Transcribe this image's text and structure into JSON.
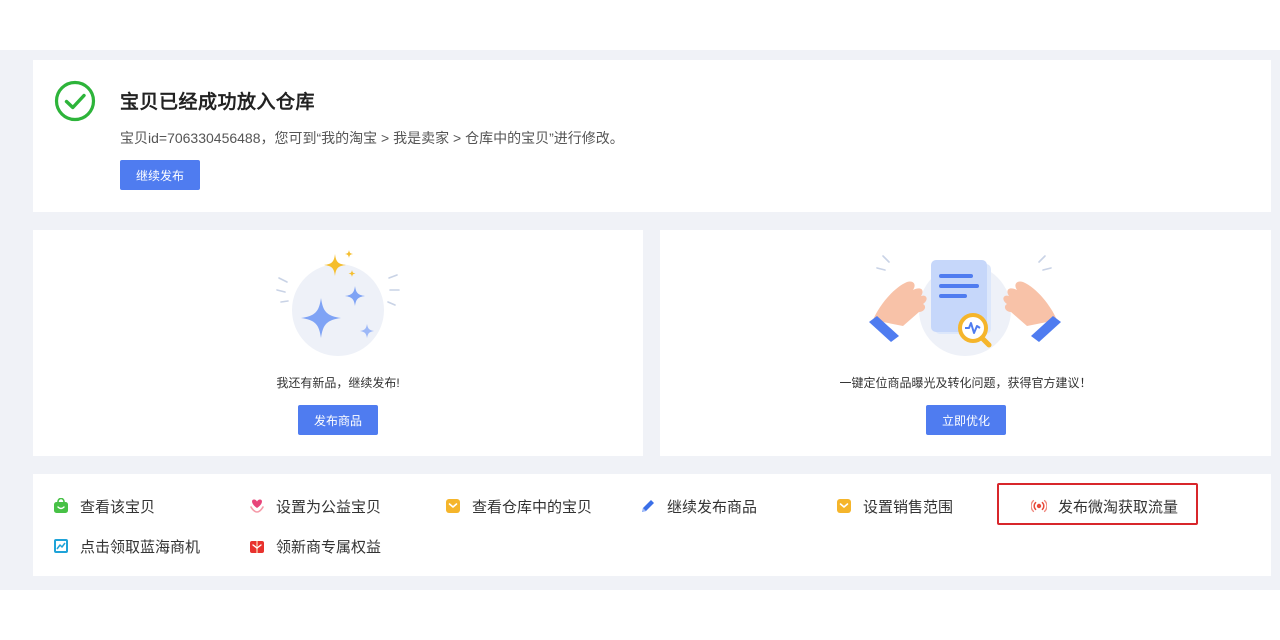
{
  "success": {
    "title": "宝贝已经成功放入仓库",
    "description": "宝贝id=706330456488，您可到“我的淘宝 > 我是卖家 > 仓库中的宝贝”进行修改。",
    "continue_button": "继续发布",
    "accent_color": "#2db43a"
  },
  "cards": [
    {
      "text": "我还有新品，继续发布!",
      "button": "发布商品",
      "illustration": "sparkle-stars-illustration"
    },
    {
      "text": "一键定位商品曝光及转化问题，获得官方建议！",
      "button": "立即优化",
      "illustration": "document-analysis-illustration"
    }
  ],
  "links": [
    {
      "label": "查看该宝贝",
      "icon": "shopping-bag-icon",
      "color": "#47c146"
    },
    {
      "label": "设置为公益宝贝",
      "icon": "heart-hand-icon",
      "color": "#e8457a"
    },
    {
      "label": "查看仓库中的宝贝",
      "icon": "box-icon",
      "color": "#f5b52b"
    },
    {
      "label": "继续发布商品",
      "icon": "pencil-icon",
      "color": "#3a6fe8"
    },
    {
      "label": "设置销售范围",
      "icon": "range-icon",
      "color": "#f5b52b"
    },
    {
      "label": "发布微淘获取流量",
      "icon": "broadcast-icon",
      "color": "#e84a3a"
    },
    {
      "label": "点击领取蓝海商机",
      "icon": "chart-icon",
      "color": "#1fa3d8"
    },
    {
      "label": "领新商专属权益",
      "icon": "gift-icon",
      "color": "#e8322e"
    }
  ],
  "theme": {
    "primary": "#4f7cf0",
    "highlight_border": "#d8262b"
  }
}
